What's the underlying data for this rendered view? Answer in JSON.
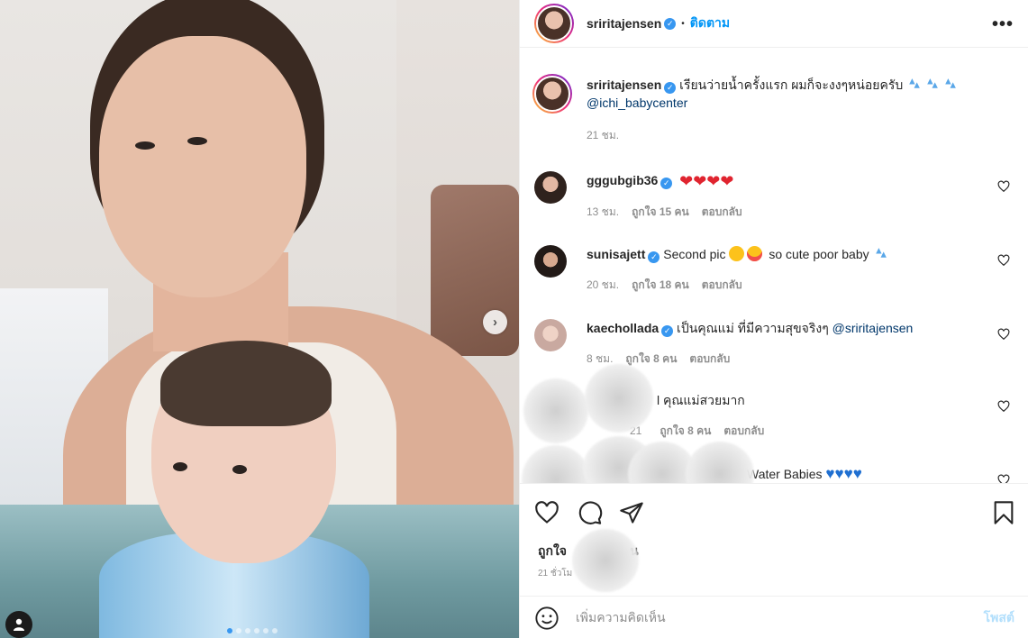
{
  "post": {
    "author": "sriritajensen",
    "follow_label": "ติดตาม",
    "more_label": "•••",
    "caption": "เรียนว่ายน้ำครั้งแรก ผมก็จะงงๆหน่อยครับ",
    "caption_mention": "@ichi_babycenter",
    "caption_time": "21 ชม.",
    "likes_prefix": "ถูกใจ",
    "likes_suffix": "น",
    "timestamp": "21 ชั่วโม",
    "carousel_total": 6,
    "carousel_active": 0
  },
  "comments": [
    {
      "user": "gggubgib36",
      "text": "",
      "time": "13 ชม.",
      "likes": "ถูกใจ 15 คน",
      "reply": "ตอบกลับ",
      "verified": true
    },
    {
      "user": "sunisajett",
      "text": "Second pic",
      "text2": "so cute poor baby",
      "time": "20 ชม.",
      "likes": "ถูกใจ 18 คน",
      "reply": "ตอบกลับ",
      "verified": true
    },
    {
      "user": "kaechollada",
      "text": "เป็นคุณแม่ ที่มีความสุขจริงๆ",
      "mention": "@sriritajensen",
      "time": "8 ชม.",
      "likes": "ถูกใจ 8 คน",
      "reply": "ตอบกลับ",
      "verified": true
    },
    {
      "user": "",
      "text": "l คุณแม่สวยมาก",
      "time": "21",
      "likes": "ถูกใจ 8 คน",
      "reply": "ตอบกลับ",
      "verified": false
    },
    {
      "user": "",
      "text": "Water Babies",
      "time": "",
      "likes": "",
      "reply": "",
      "verified": false
    }
  ],
  "composer": {
    "placeholder": "เพิ่มความคิดเห็น",
    "post_label": "โพสต์"
  },
  "icons": [
    "next-icon",
    "user-tag-icon",
    "verified-icon",
    "more-icon",
    "heart-icon",
    "comment-icon",
    "share-icon",
    "bookmark-icon",
    "emoji-icon",
    "splash-emoji-icon",
    "red-heart-emoji-icon",
    "blue-heart-emoji-icon",
    "laugh-emoji-icon",
    "heart-eyes-emoji-icon"
  ],
  "colors": {
    "accent": "#0095f6",
    "verified": "#3897f0",
    "muted": "#8e8e8e",
    "post_disabled": "#b2dffc"
  }
}
